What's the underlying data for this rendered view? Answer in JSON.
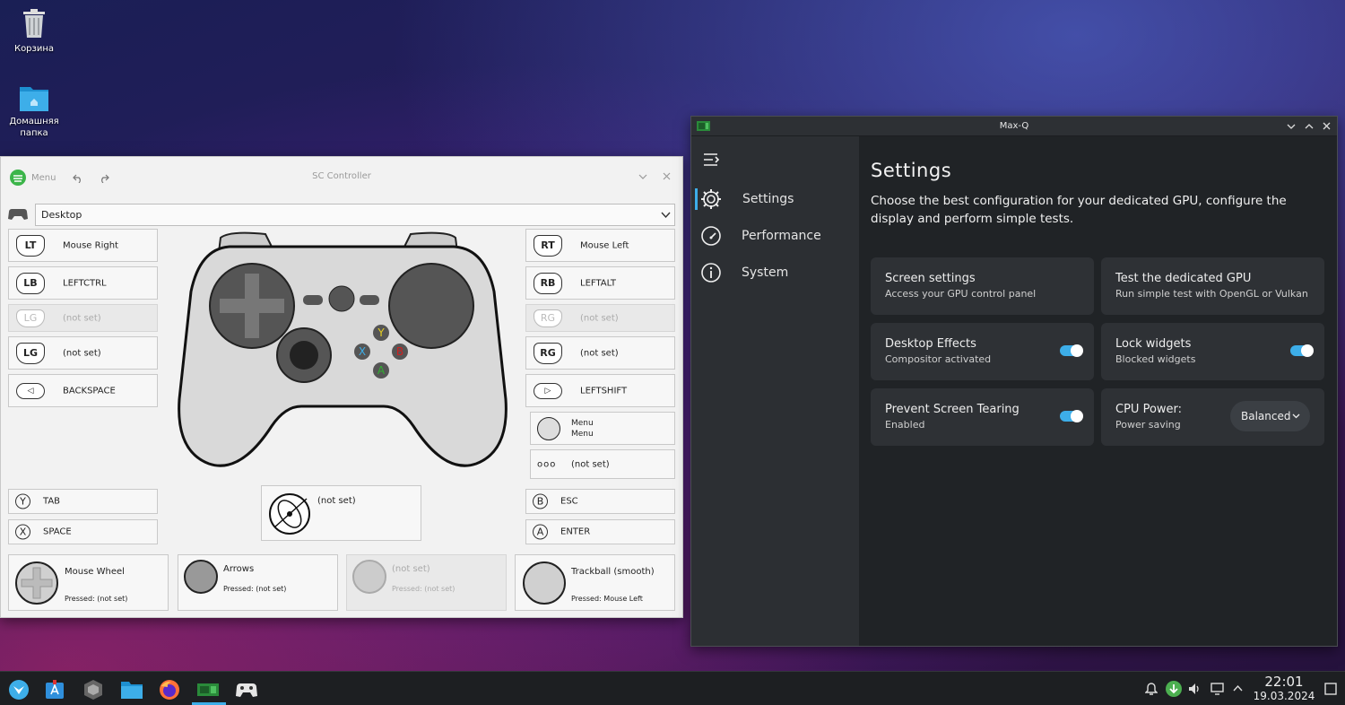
{
  "desktop": {
    "trash_label": "Корзина",
    "home_label": "Домашняя папка"
  },
  "sc": {
    "window_title": "SC Controller",
    "menu_label": "Menu",
    "profile": "Desktop",
    "left": [
      {
        "badge": "LT",
        "label": "Mouse Right",
        "disabled": false
      },
      {
        "badge": "LB",
        "label": "LEFTCTRL",
        "disabled": false
      },
      {
        "badge": "LG",
        "label": "(not set)",
        "disabled": true
      },
      {
        "badge": "LG",
        "label": "(not set)",
        "disabled": false
      },
      {
        "badge": "◁",
        "label": "BACKSPACE",
        "disabled": false
      }
    ],
    "right": [
      {
        "badge": "RT",
        "label": "Mouse Left",
        "disabled": false
      },
      {
        "badge": "RB",
        "label": "LEFTALT",
        "disabled": false
      },
      {
        "badge": "RG",
        "label": "(not set)",
        "disabled": true
      },
      {
        "badge": "RG",
        "label": "(not set)",
        "disabled": false
      },
      {
        "badge": "▷",
        "label": "LEFTSHIFT",
        "disabled": false
      }
    ],
    "menu_btn": {
      "line1": "Menu",
      "line2": "Menu"
    },
    "ooo_btn": {
      "badge": "ooo",
      "label": "(not set)"
    },
    "gyro": {
      "label": "(not set)"
    },
    "face_left": [
      {
        "badge": "Y",
        "label": "TAB"
      },
      {
        "badge": "X",
        "label": "SPACE"
      }
    ],
    "face_right": [
      {
        "badge": "B",
        "label": "ESC"
      },
      {
        "badge": "A",
        "label": "ENTER"
      }
    ],
    "pads": [
      {
        "title": "Mouse Wheel",
        "pressed": "Pressed: (not set)",
        "disabled": false
      },
      {
        "title": "Arrows",
        "pressed": "Pressed: (not set)",
        "disabled": false
      },
      {
        "title": "(not set)",
        "pressed": "Pressed: (not set)",
        "disabled": true
      },
      {
        "title": "Trackball (smooth)",
        "pressed": "Pressed: Mouse Left",
        "disabled": false
      }
    ],
    "gamepad_letters": {
      "y": "Y",
      "x": "X",
      "b": "B",
      "a": "A"
    }
  },
  "maxq": {
    "window_title": "Max-Q",
    "nav": [
      {
        "label": "Settings",
        "icon": "gear-icon"
      },
      {
        "label": "Performance",
        "icon": "gauge-icon"
      },
      {
        "label": "System",
        "icon": "info-icon"
      }
    ],
    "heading": "Settings",
    "description": "Choose the best configuration for your dedicated GPU, configure the display and perform simple tests.",
    "cards": [
      {
        "title": "Screen settings",
        "sub": "Access your GPU control panel",
        "type": "link"
      },
      {
        "title": "Test the dedicated GPU",
        "sub": "Run simple test with OpenGL or Vulkan",
        "type": "link"
      },
      {
        "title": "Desktop Effects",
        "sub": "Compositor activated",
        "type": "toggle",
        "on": true
      },
      {
        "title": "Lock widgets",
        "sub": "Blocked widgets",
        "type": "toggle",
        "on": true
      },
      {
        "title": "Prevent Screen Tearing",
        "sub": "Enabled",
        "type": "toggle",
        "on": true
      },
      {
        "title": "CPU Power:",
        "sub": "Power saving",
        "type": "select",
        "value": "Balanced"
      }
    ],
    "accent": "#3daee9"
  },
  "taskbar": {
    "time": "22:01",
    "date": "19.03.2024"
  }
}
